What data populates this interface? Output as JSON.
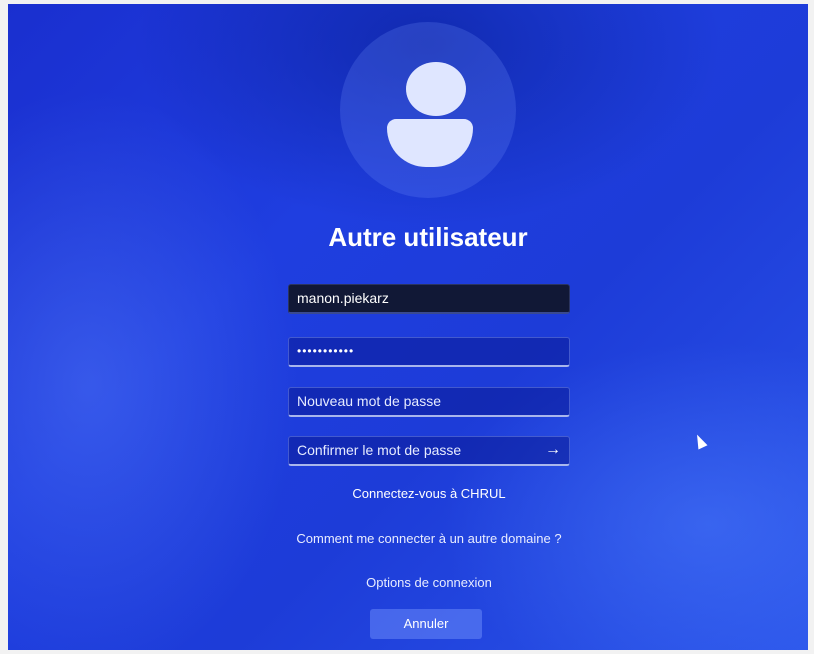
{
  "login": {
    "title": "Autre utilisateur",
    "username_value": "manon.piekarz",
    "password_value": "•••••••••••",
    "new_password_placeholder": "Nouveau mot de passe",
    "confirm_password_placeholder": "Confirmer le mot de passe",
    "submit_icon": "arrow-right-icon",
    "submit_glyph": "→",
    "domain_link": "Connectez-vous à CHRUL",
    "other_domain_link": "Comment me connecter à un autre domaine ?",
    "sign_in_options": "Options de connexion",
    "cancel_label": "Annuler"
  },
  "icons": {
    "avatar": "user-avatar-icon",
    "cursor": "mouse-pointer-icon"
  },
  "colors": {
    "background": "#1f3ee0",
    "text": "#ffffff",
    "field_background": "#111836"
  }
}
